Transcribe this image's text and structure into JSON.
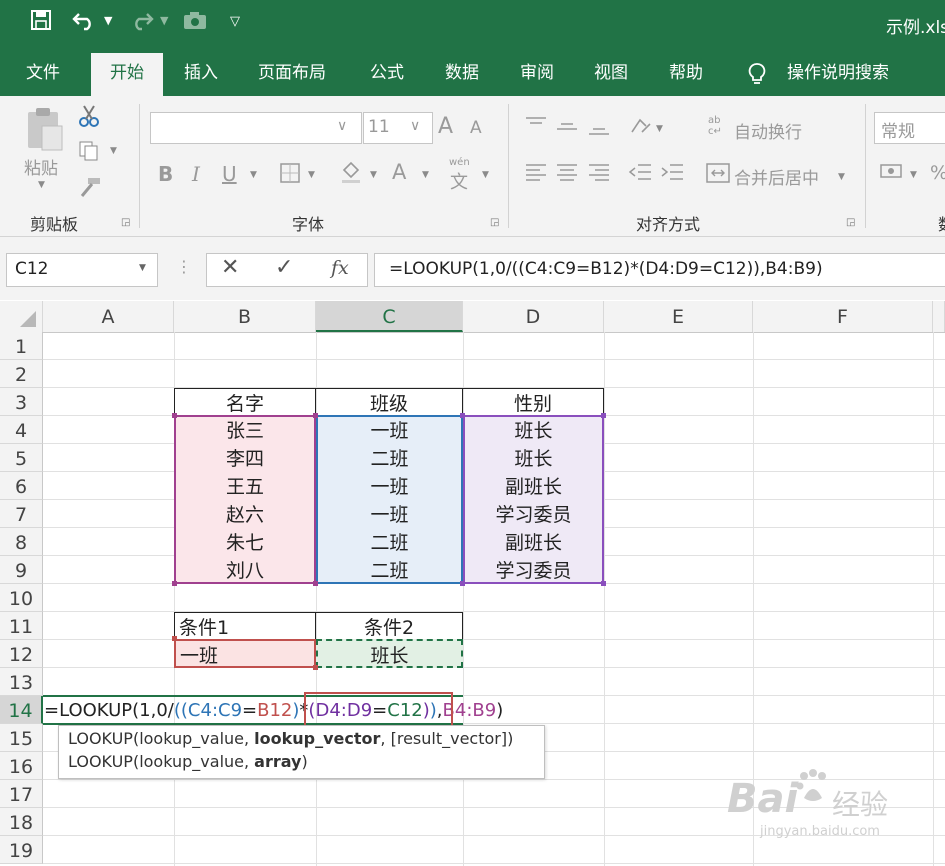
{
  "title_bar": {
    "file_name": "示例.xls"
  },
  "tabs": [
    "文件",
    "开始",
    "插入",
    "页面布局",
    "公式",
    "数据",
    "审阅",
    "视图",
    "帮助"
  ],
  "tell_me": "操作说明搜索",
  "ribbon": {
    "paste_label": "粘贴",
    "font_size": "11",
    "wrap_text": "自动换行",
    "merge_center": "合并后居中",
    "number_format": "常规",
    "percent": "%",
    "wen_label": "wén",
    "wen_char": "文",
    "font_grow": "A",
    "font_shrink": "A",
    "bold": "B",
    "italic": "I",
    "underline": "U",
    "font_color": "A",
    "groups": {
      "clipboard": "剪贴板",
      "font": "字体",
      "alignment": "对齐方式",
      "number": "数"
    }
  },
  "formula_bar": {
    "name_box": "C12",
    "cancel": "✕",
    "confirm": "✓",
    "fx": "fx",
    "formula": "=LOOKUP(1,0/((C4:C9=B12)*(D4:D9=C12)),B4:B9)"
  },
  "columns": [
    "A",
    "B",
    "C",
    "D",
    "E",
    "F"
  ],
  "rows": [
    "1",
    "2",
    "3",
    "4",
    "5",
    "6",
    "7",
    "8",
    "9",
    "10",
    "11",
    "12",
    "13",
    "14",
    "15",
    "16",
    "17",
    "18",
    "19"
  ],
  "table": {
    "headers": [
      "名字",
      "班级",
      "性别"
    ],
    "rows": [
      [
        "张三",
        "一班",
        "班长"
      ],
      [
        "李四",
        "二班",
        "班长"
      ],
      [
        "王五",
        "一班",
        "副班长"
      ],
      [
        "赵六",
        "一班",
        "学习委员"
      ],
      [
        "朱七",
        "二班",
        "副班长"
      ],
      [
        "刘八",
        "二班",
        "学习委员"
      ]
    ]
  },
  "conditions": {
    "label1": "条件1",
    "label2": "条件2",
    "value1": "一班",
    "value2": "班长"
  },
  "editing_formula": {
    "p1": "=LOOKUP(1,0/",
    "p2": "((",
    "p3": "C4:C9",
    "p4": "=",
    "p5": "B12",
    "p6": ")",
    "p7": "*",
    "p8": "(",
    "p9": "D4:D9",
    "p10": "=",
    "p11": "C12",
    "p12": ")",
    "p13": ")",
    "p14": ",",
    "p15": "B4:B9",
    "p16": ")"
  },
  "tooltip": {
    "line1_a": "LOOKUP(lookup_value, ",
    "line1_b": "lookup_vector",
    "line1_c": ", [result_vector])",
    "line2_a": "LOOKUP(lookup_value, ",
    "line2_b": "array",
    "line2_c": ")"
  },
  "watermark": {
    "brand": "Bai",
    "brand2": "经验",
    "url": "jingyan.baidu.com"
  },
  "colors": {
    "excel_green": "#217346",
    "ref_c": "#2e75b6",
    "ref_b12": "#c0504d",
    "ref_d": "#7030a0",
    "ref_c12": "#217346",
    "highlight_box": "#c0504d"
  }
}
